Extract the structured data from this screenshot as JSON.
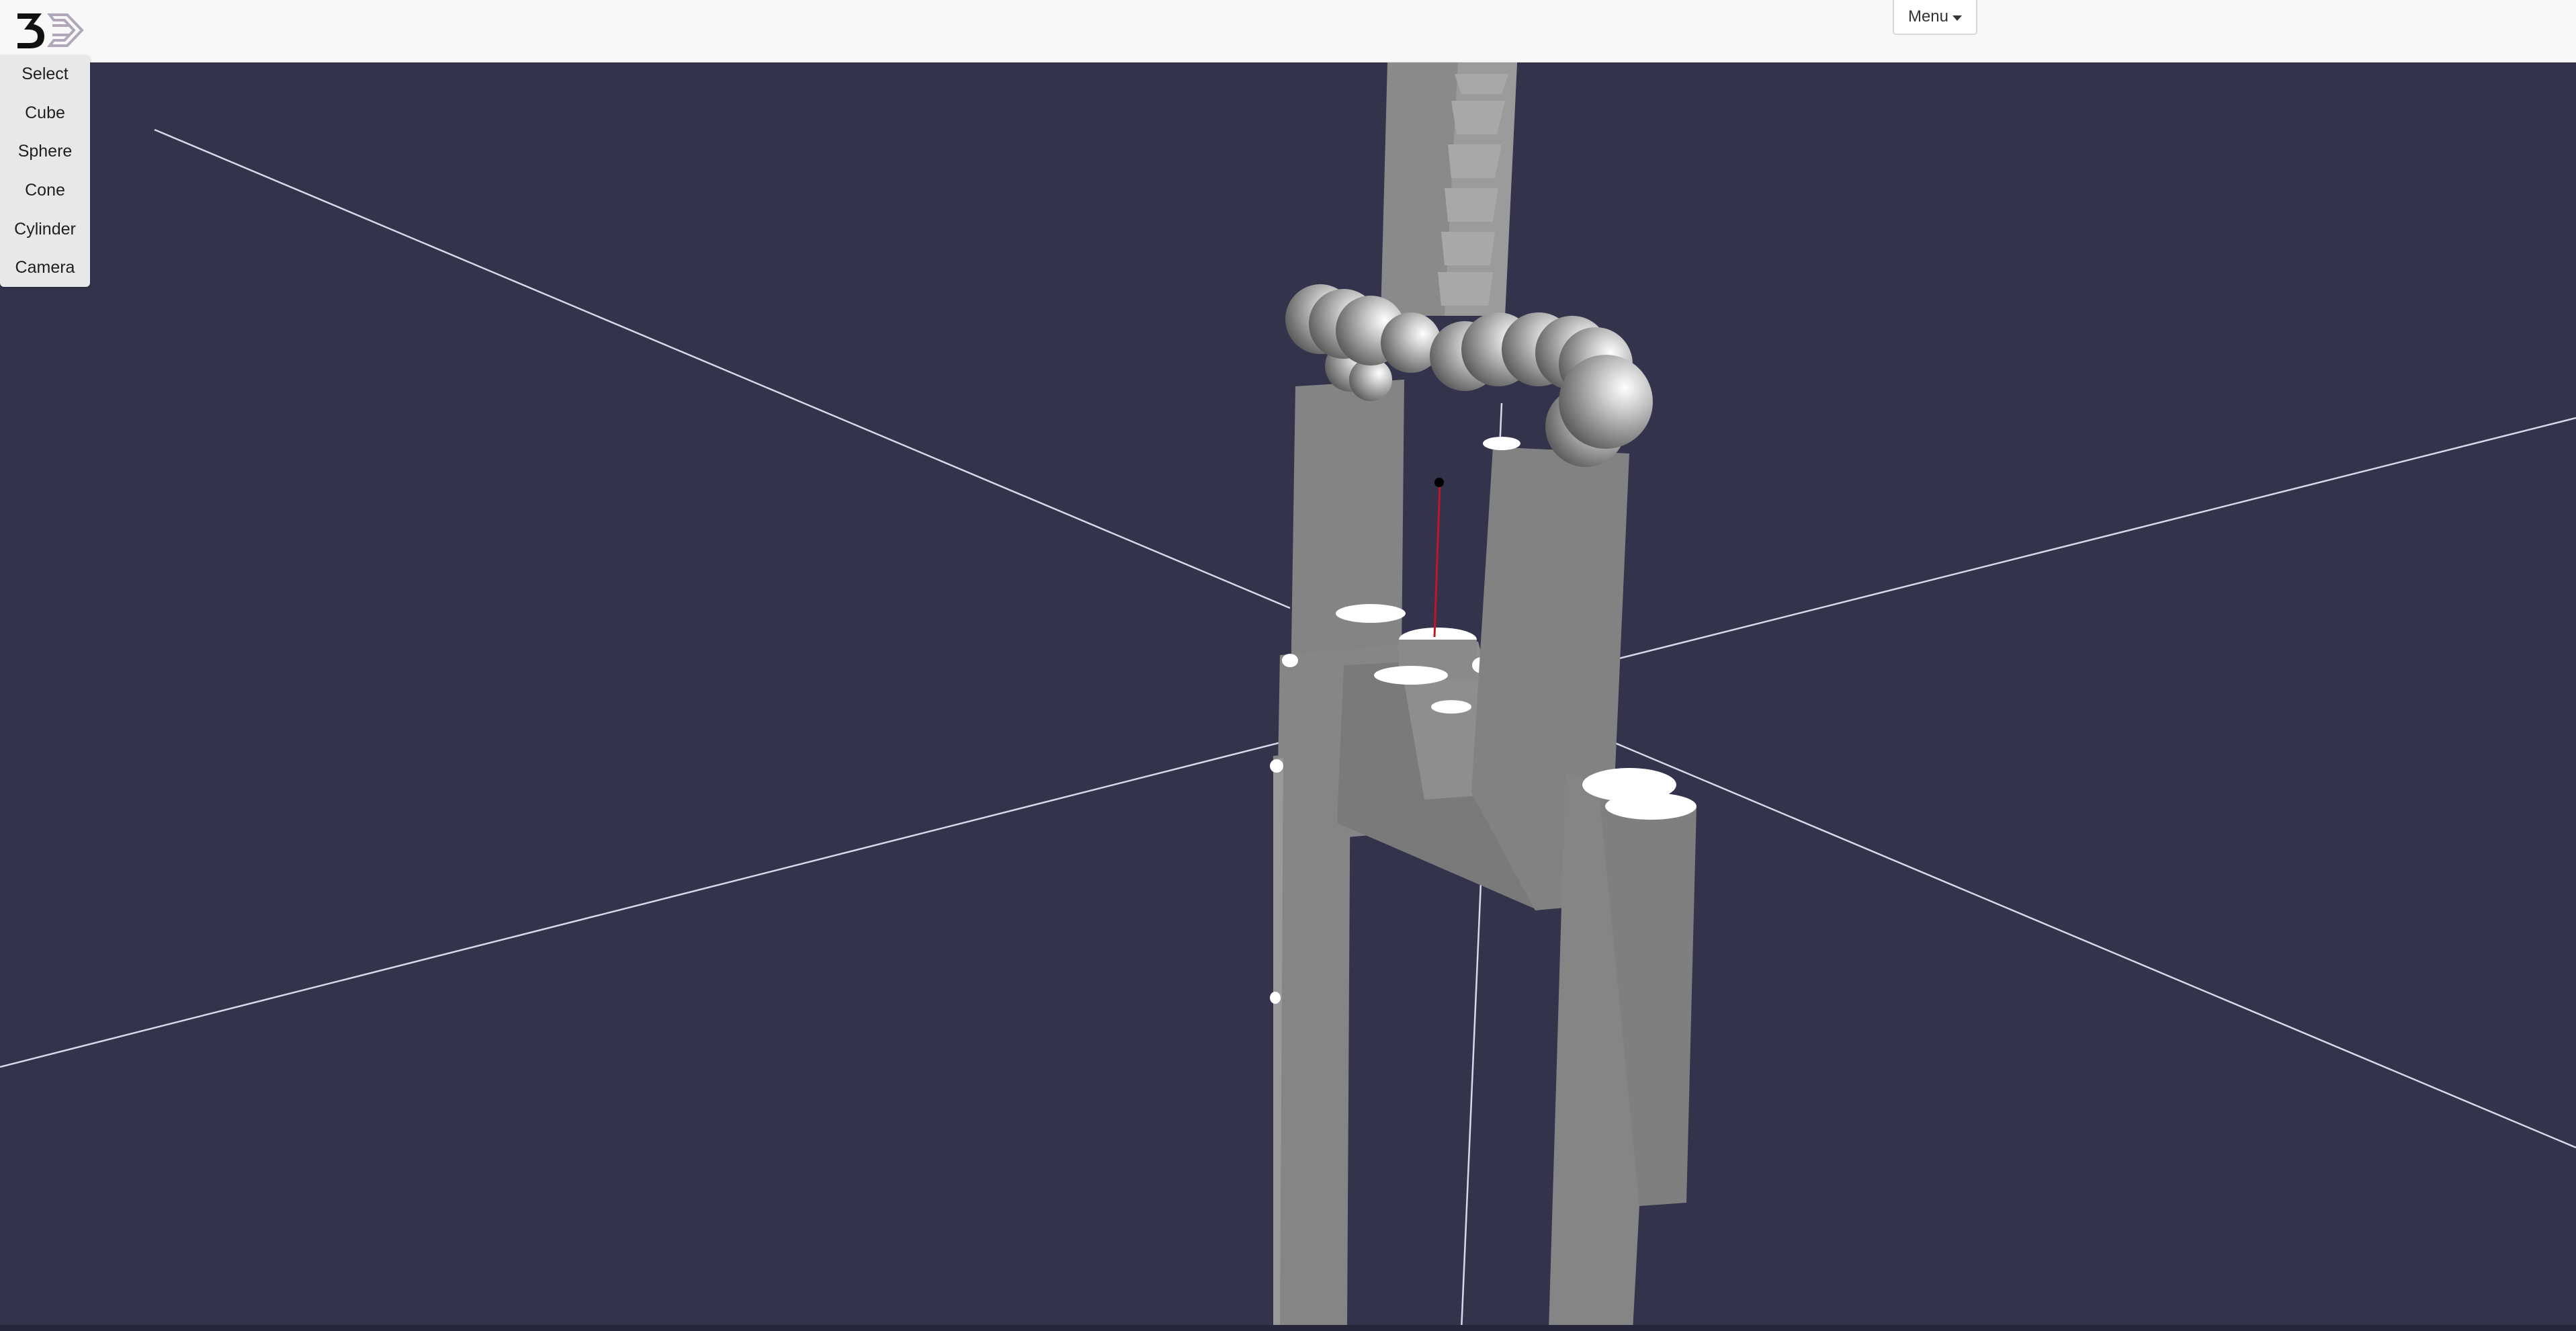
{
  "app": {
    "logo_icon": "threejs-editor-logo-icon",
    "menu_label": "Menu",
    "menu_icon": "caret-down-icon"
  },
  "toolbox": {
    "items": [
      {
        "label": "Select"
      },
      {
        "label": "Cube"
      },
      {
        "label": "Sphere"
      },
      {
        "label": "Cone"
      },
      {
        "label": "Cylinder"
      },
      {
        "label": "Camera"
      }
    ]
  },
  "viewport": {
    "background": "#33334c",
    "grid_line_color": "#d8d8e8",
    "object_color": "#878787",
    "highlight_color": "#ffffff",
    "selection_line_color": "#c0162a"
  }
}
